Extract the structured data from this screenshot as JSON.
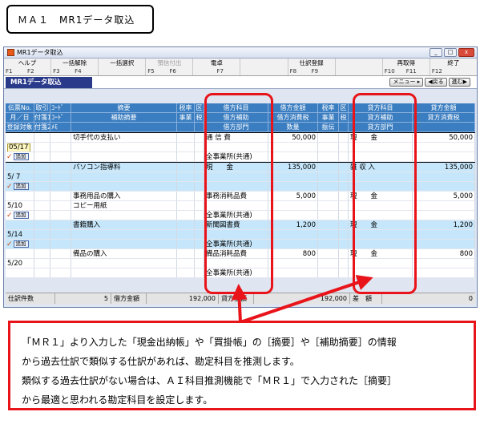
{
  "page_title": "ＭＡ１　MR1データ取込",
  "window": {
    "title": "MR1データ取込",
    "controls": [
      "_",
      "□",
      "x"
    ]
  },
  "fkeys": [
    {
      "label": "ヘルプ",
      "key": "F1",
      "key2": "F2",
      "enabled": true
    },
    {
      "label": "一括解除",
      "key": "F3",
      "key2": "F4",
      "enabled": true
    },
    {
      "label": "一括選択",
      "key": "",
      "key2": "",
      "enabled": true
    },
    {
      "label": "預信付出",
      "key": "F5",
      "key2": "F6",
      "enabled": false
    },
    {
      "label": "電卓",
      "key": "",
      "key2": "F7",
      "enabled": true
    },
    {
      "label": "",
      "key": "",
      "key2": "",
      "enabled": true
    },
    {
      "label": "仕訳登録",
      "key": "F8",
      "key2": "F9",
      "enabled": true
    },
    {
      "label": "",
      "key": "",
      "key2": "",
      "enabled": true
    },
    {
      "label": "再取得",
      "key": "F10",
      "key2": "F11",
      "enabled": true
    },
    {
      "label": "終了",
      "key": "F12",
      "key2": "",
      "enabled": true
    }
  ],
  "form_title": "MR1データ取込",
  "nav": {
    "menu": "メニュー ▸",
    "prev": "◀戻る",
    "next": "進む▶"
  },
  "headers": {
    "row1": [
      "伝票No.",
      "取引",
      "ｺｰﾄﾞ",
      "摘要",
      "税率",
      "区",
      "借方科目",
      "借方金額",
      "税率",
      "区",
      "貸方科目",
      "貸方金額"
    ],
    "row2": [
      "月／日",
      "付箋1",
      "ｺｰﾄﾞ",
      "補助摘要",
      "事業",
      "税",
      "借方補助",
      "借方消費税",
      "事業",
      "税",
      "貸方補助",
      "貸方消費税"
    ],
    "row3": [
      "登録対象",
      "付箋2",
      "ﾒﾓ",
      "",
      "",
      "",
      "借方部門",
      "数量",
      "振伝",
      "",
      "貸方部門",
      ""
    ]
  },
  "add_label": "追加",
  "check_mark": "✓",
  "entries": [
    {
      "date": "05/17",
      "summary": "切手代の支払い",
      "sub_summary": "",
      "debit": "通 信 費",
      "debit_dept": "全事業所(共通)",
      "debit_amount": "50,000",
      "credit": "現　　金",
      "credit_amount": "50,000",
      "selected": true
    },
    {
      "date": "5/ 7",
      "summary": "パソコン指導料",
      "sub_summary": "",
      "debit": "現　　金",
      "debit_dept": "",
      "debit_amount": "135,000",
      "credit": "雑 収 入",
      "credit_amount": "135,000",
      "selected": false
    },
    {
      "date": "5/10",
      "summary": "事務用品の購入",
      "sub_summary": "コピー用紙",
      "debit": "事務消耗品費",
      "debit_dept": "全事業所(共通)",
      "debit_amount": "5,000",
      "credit": "現　　金",
      "credit_amount": "5,000",
      "selected": false
    },
    {
      "date": "5/14",
      "summary": "書籍購入",
      "sub_summary": "",
      "debit": "新聞図書費",
      "debit_dept": "全事業所(共通)",
      "debit_amount": "1,200",
      "credit": "現　　金",
      "credit_amount": "1,200",
      "selected": false
    },
    {
      "date": "5/20",
      "summary": "備品の購入",
      "sub_summary": "",
      "debit": "備品消耗品費",
      "debit_dept": "全事業所(共通)",
      "debit_amount": "800",
      "credit": "現　　金",
      "credit_amount": "800",
      "selected": false
    }
  ],
  "status": {
    "count_label": "仕訳件数",
    "count": "5",
    "debit_label": "借方金額",
    "debit_total": "192,000",
    "credit_label": "貸方金額",
    "credit_total": "192,000",
    "diff_label": "差　額",
    "diff": "0"
  },
  "callout": {
    "line1": "「ＭＲ１」より入力した「現金出納帳」や「買掛帳」の［摘要］や［補助摘要］の情報",
    "line2": "から過去仕訳で類似する仕訳があれば、勘定科目を推測します。",
    "line3": "類似する過去仕訳がない場合は、ＡＩ科目推測機能で「ＭＲ１」で入力された［摘要］",
    "line4": "から最適と思われる勘定科目を設定します。"
  },
  "colors": {
    "highlight": "#e8141a",
    "header": "#3a7dc0",
    "row_alt": "#c6e7fb"
  }
}
